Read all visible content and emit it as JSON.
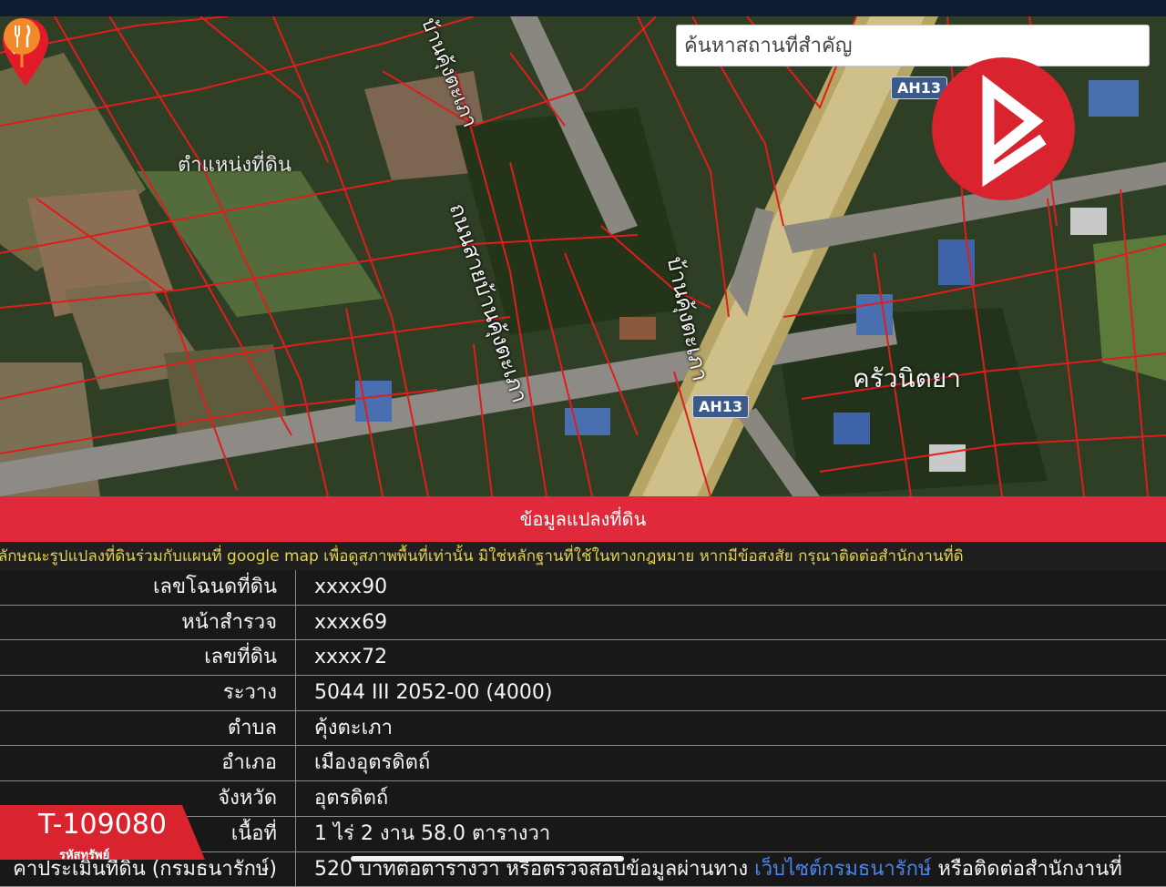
{
  "search": {
    "placeholder": "ค้นหาสถานที่สำคัญ"
  },
  "map": {
    "pin_label": "ตำแหน่งที่ดิน",
    "road_label_1": "ถนนสายบ้านคุ้งตะเภา",
    "road_label_2": "บ้านคุ้งตะเภา",
    "road_label_3": "บ้านคุ้งตะเภา",
    "highway_badge_top": "AH13",
    "highway_badge_bottom": "AH13",
    "restaurant_label": "ครัวนิตยา"
  },
  "panel": {
    "title": "ข้อมูลแปลงที่ดิน",
    "disclaimer": "างลักษณะรูปแปลงที่ดินร่วมกับแผนที่ google map เพื่อดูสภาพพื้นที่เท่านั้น มิใช่หลักฐานที่ใช้ในทางกฎหมาย หากมีข้อสงสัย กรุณาติดต่อสำนักงานที่ดิ",
    "rows": [
      {
        "key": "เลขโฉนดที่ดิน",
        "value": "xxxx90"
      },
      {
        "key": "หน้าสำรวจ",
        "value": "xxxx69"
      },
      {
        "key": "เลขที่ดิน",
        "value": "xxxx72"
      },
      {
        "key": "ระวาง",
        "value": "5044 III 2052-00 (4000)"
      },
      {
        "key": "ตำบล",
        "value": "คุ้งตะเภา"
      },
      {
        "key": "อำเภอ",
        "value": "เมืองอุตรดิตถ์"
      },
      {
        "key": "จังหวัด",
        "value": "อุตรดิตถ์"
      },
      {
        "key": "เนื้อที่",
        "value": "1 ไร่ 2 งาน 58.0 ตารางวา"
      }
    ],
    "last_row": {
      "key": "คาประเมินที่ดิน (กรมธนารักษ์)",
      "value_pre": "520 บาทต่อตารางวา หรือตรวจสอบข้อมูลผ่านทาง",
      "link": "เว็บไซต์กรมธนารักษ์",
      "value_post": "หรือติดต่อสำนักงานที่"
    }
  },
  "badge": {
    "code": "T-109080",
    "caption": "รหัสทรัพย์"
  },
  "colors": {
    "accent_red": "#e0293a",
    "disclaimer_yellow": "#e6d24a",
    "link_blue": "#4b84e8"
  }
}
